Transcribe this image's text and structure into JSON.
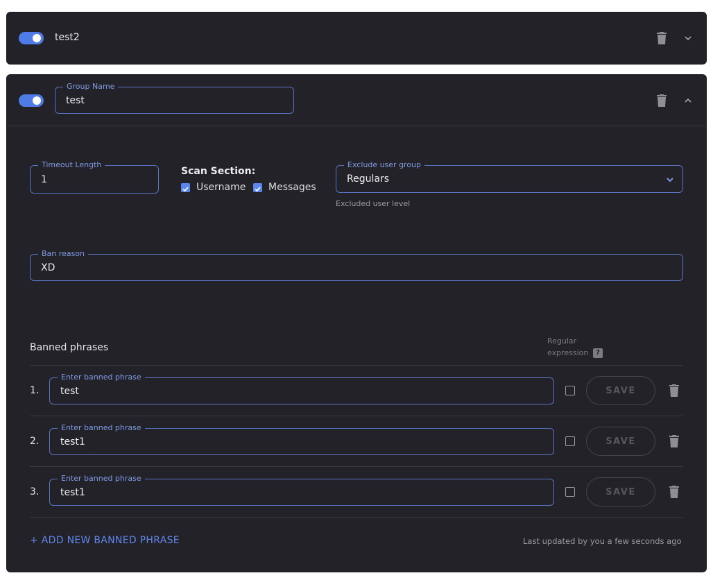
{
  "groups": [
    {
      "name": "test2",
      "enabled": true,
      "expanded": false
    },
    {
      "name_label": "Group Name",
      "name": "test",
      "enabled": true,
      "expanded": true
    }
  ],
  "settings": {
    "timeout": {
      "label": "Timeout Length",
      "value": "1"
    },
    "scan_section": {
      "title": "Scan Section:",
      "username_label": "Username",
      "username_checked": true,
      "messages_label": "Messages",
      "messages_checked": true
    },
    "exclude_group": {
      "label": "Exclude user group",
      "value": "Regulars",
      "helper": "Excluded user level"
    },
    "ban_reason": {
      "label": "Ban reason",
      "value": "XD"
    }
  },
  "phrases": {
    "title": "Banned phrases",
    "regex_header_line1": "Regular",
    "regex_header_line2": "expression",
    "regex_help": "?",
    "field_label": "Enter banned phrase",
    "save_label": "SAVE",
    "items": [
      {
        "index": "1.",
        "value": "test",
        "regex": false
      },
      {
        "index": "2.",
        "value": "test1",
        "regex": false
      },
      {
        "index": "3.",
        "value": "test1",
        "regex": false
      }
    ],
    "add_label": "+ ADD NEW BANNED PHRASE",
    "last_updated": "Last updated by you a few seconds ago"
  },
  "colors": {
    "accent": "#4f7be6",
    "card": "#232228",
    "border": "#5b75c4"
  },
  "icons": {
    "delete": "trash-icon",
    "collapse": "chevron-up-icon",
    "expand": "chevron-down-icon",
    "dropdown": "chevron-down-icon"
  }
}
